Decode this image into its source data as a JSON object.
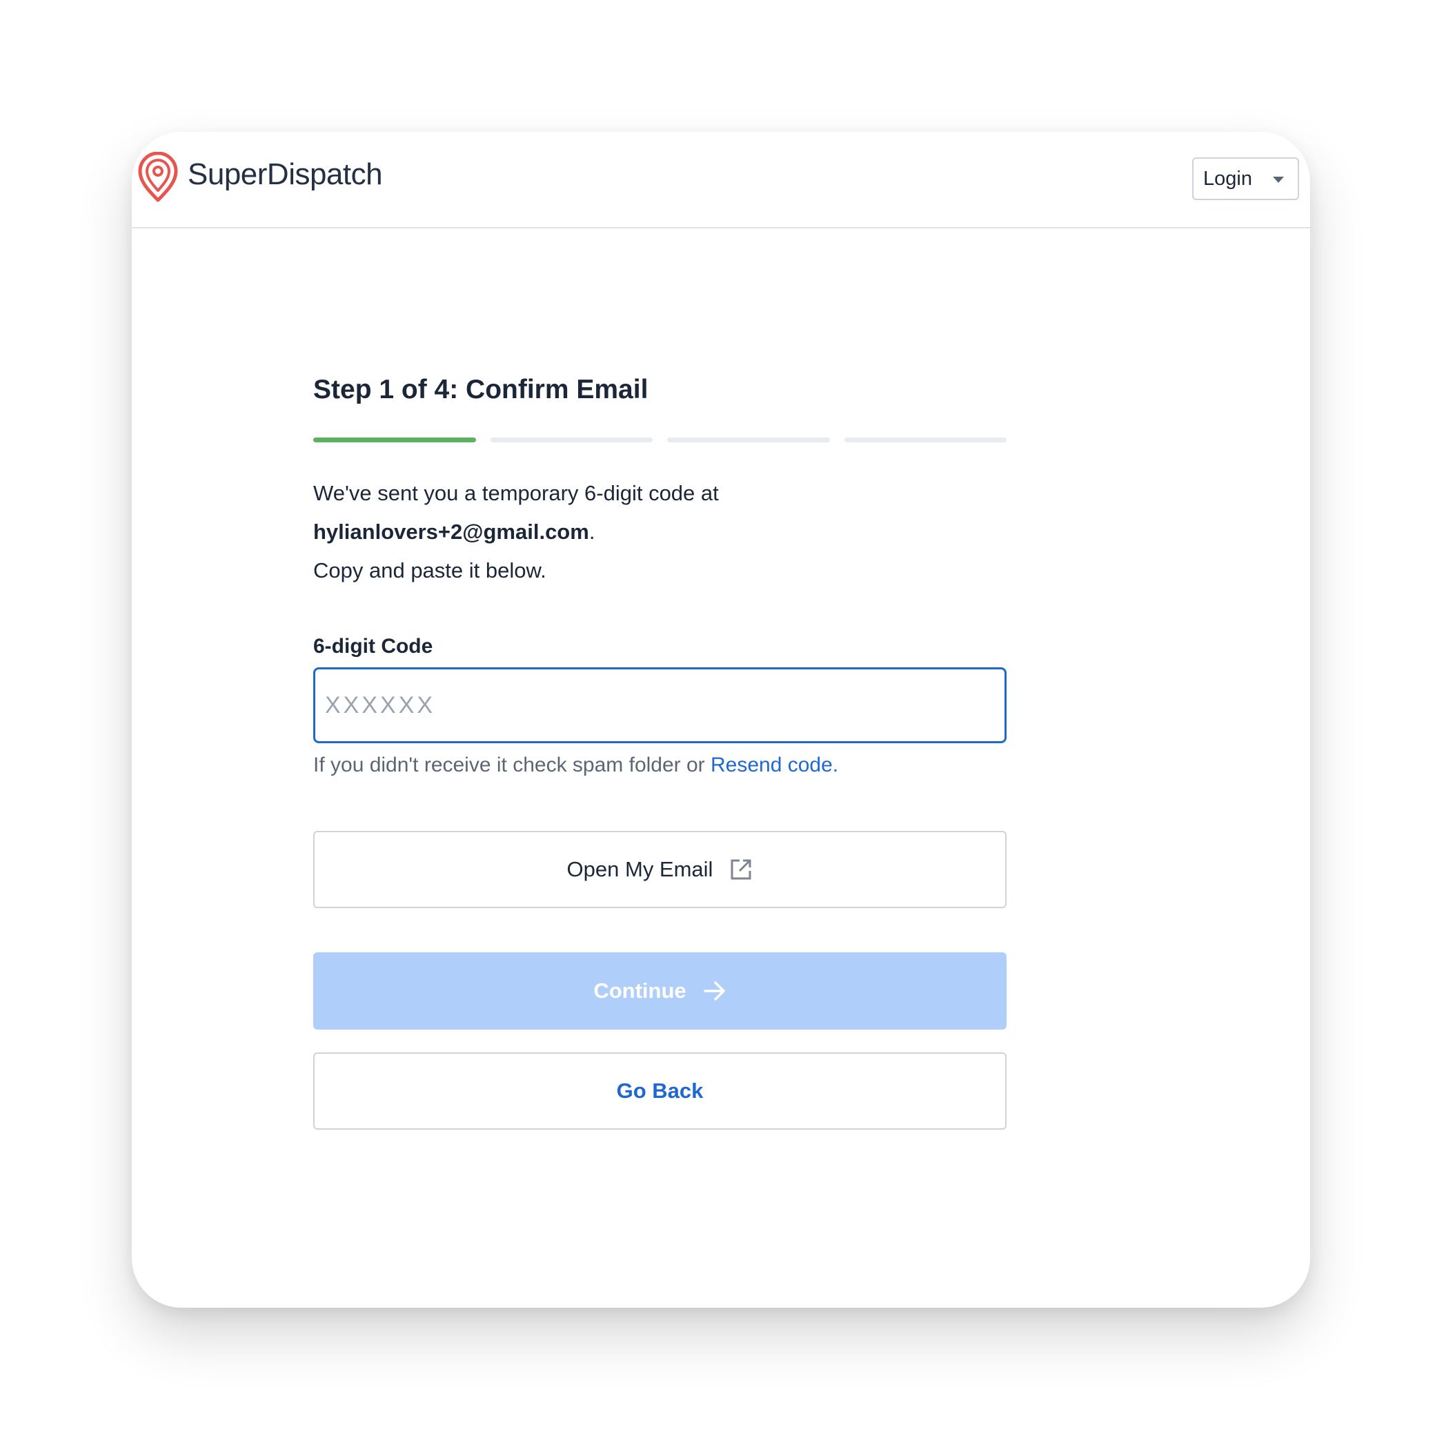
{
  "header": {
    "brand": "SuperDispatch",
    "login_select": {
      "selected": "Login"
    }
  },
  "main": {
    "title": "Step 1 of 4: Confirm Email",
    "progress": {
      "current_step": 1,
      "total_steps": 4
    },
    "description": {
      "line1": "We've sent you a temporary 6-digit code at",
      "email": "hylianlovers+2@gmail.com",
      "email_suffix": ".",
      "line3": "Copy and paste it below."
    },
    "code_field": {
      "label": "6-digit Code",
      "value": "",
      "placeholder": "XXXXXX"
    },
    "hint": {
      "text": "If you didn't receive it check spam folder or ",
      "link": "Resend code",
      "suffix": "."
    },
    "buttons": {
      "open_email": "Open My Email",
      "continue": "Continue",
      "go_back": "Go Back"
    }
  },
  "colors": {
    "brand_red": "#e8554e",
    "progress_done": "#5ab25e",
    "progress_todo": "#e8ebef",
    "link_blue": "#1e68d0",
    "continue_disabled": "#afcffa"
  },
  "icons": {
    "logo": "map-pin-icon",
    "login_caret": "caret-down-icon",
    "open_email": "external-link-icon",
    "continue": "arrow-right-icon"
  }
}
